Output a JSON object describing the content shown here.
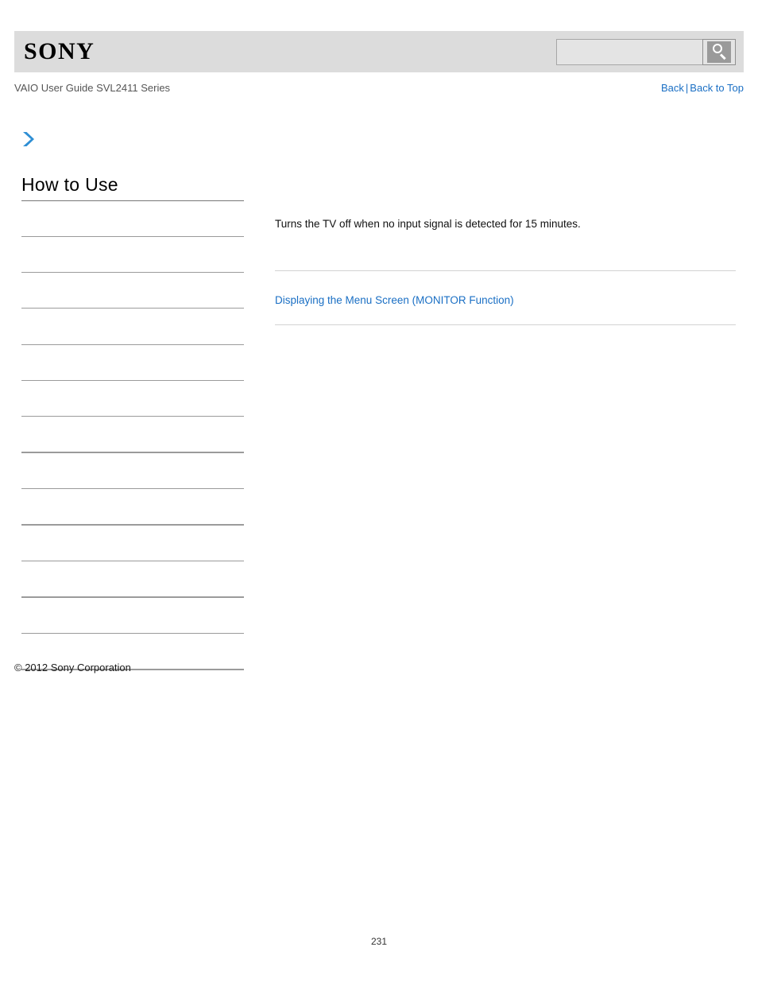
{
  "header": {
    "logo_text": "SONY",
    "search": {
      "value": "",
      "placeholder": "",
      "icon": "search-icon",
      "button_label": ""
    }
  },
  "subheader": {
    "breadcrumb": "VAIO User Guide SVL2411 Series",
    "back_label": "Back",
    "separator": "|",
    "back_to_top_label": "Back to Top"
  },
  "sidebar": {
    "expand_icon": "chevron-right-icon",
    "title": "How to Use",
    "items": [
      {
        "label": ""
      },
      {
        "label": ""
      },
      {
        "label": ""
      },
      {
        "label": ""
      },
      {
        "label": ""
      },
      {
        "label": ""
      },
      {
        "label": ""
      },
      {
        "label": ""
      },
      {
        "label": ""
      },
      {
        "label": ""
      },
      {
        "label": ""
      },
      {
        "label": ""
      },
      {
        "label": ""
      }
    ]
  },
  "main": {
    "paragraph": "Turns the TV off when no input signal is detected for 15 minutes.",
    "related_link": "Displaying the Menu Screen (MONITOR Function)"
  },
  "footer": {
    "copyright": "© 2012 Sony Corporation",
    "page_number": "231"
  },
  "colors": {
    "link": "#1a6fc4",
    "header_bar": "#dcdcdc",
    "accent": "#2f8fd4"
  }
}
